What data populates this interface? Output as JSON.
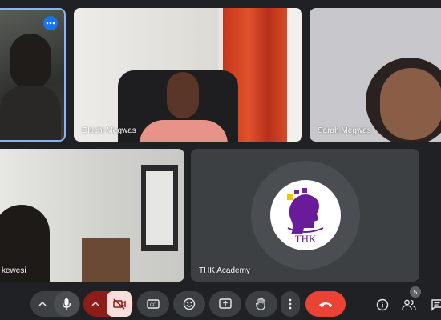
{
  "participants": [
    {
      "name": ""
    },
    {
      "name": "Chichi Megwas"
    },
    {
      "name": "Sarah Megwas"
    },
    {
      "name": "kewesi"
    },
    {
      "name": "THK Academy"
    }
  ],
  "thk_logo_text": "THK",
  "people_count": "5",
  "colors": {
    "background": "#202124",
    "tile": "#3c4043",
    "accent": "#8ab4f8",
    "end_call": "#ea4335",
    "logo_purple": "#6a1b9a"
  },
  "icons": [
    "more-options-icon",
    "mic-icon",
    "camera-off-icon",
    "captions-icon",
    "emoji-icon",
    "present-icon",
    "hand-icon",
    "more-vert-icon",
    "call-end-icon",
    "info-icon",
    "people-icon",
    "chat-icon"
  ]
}
